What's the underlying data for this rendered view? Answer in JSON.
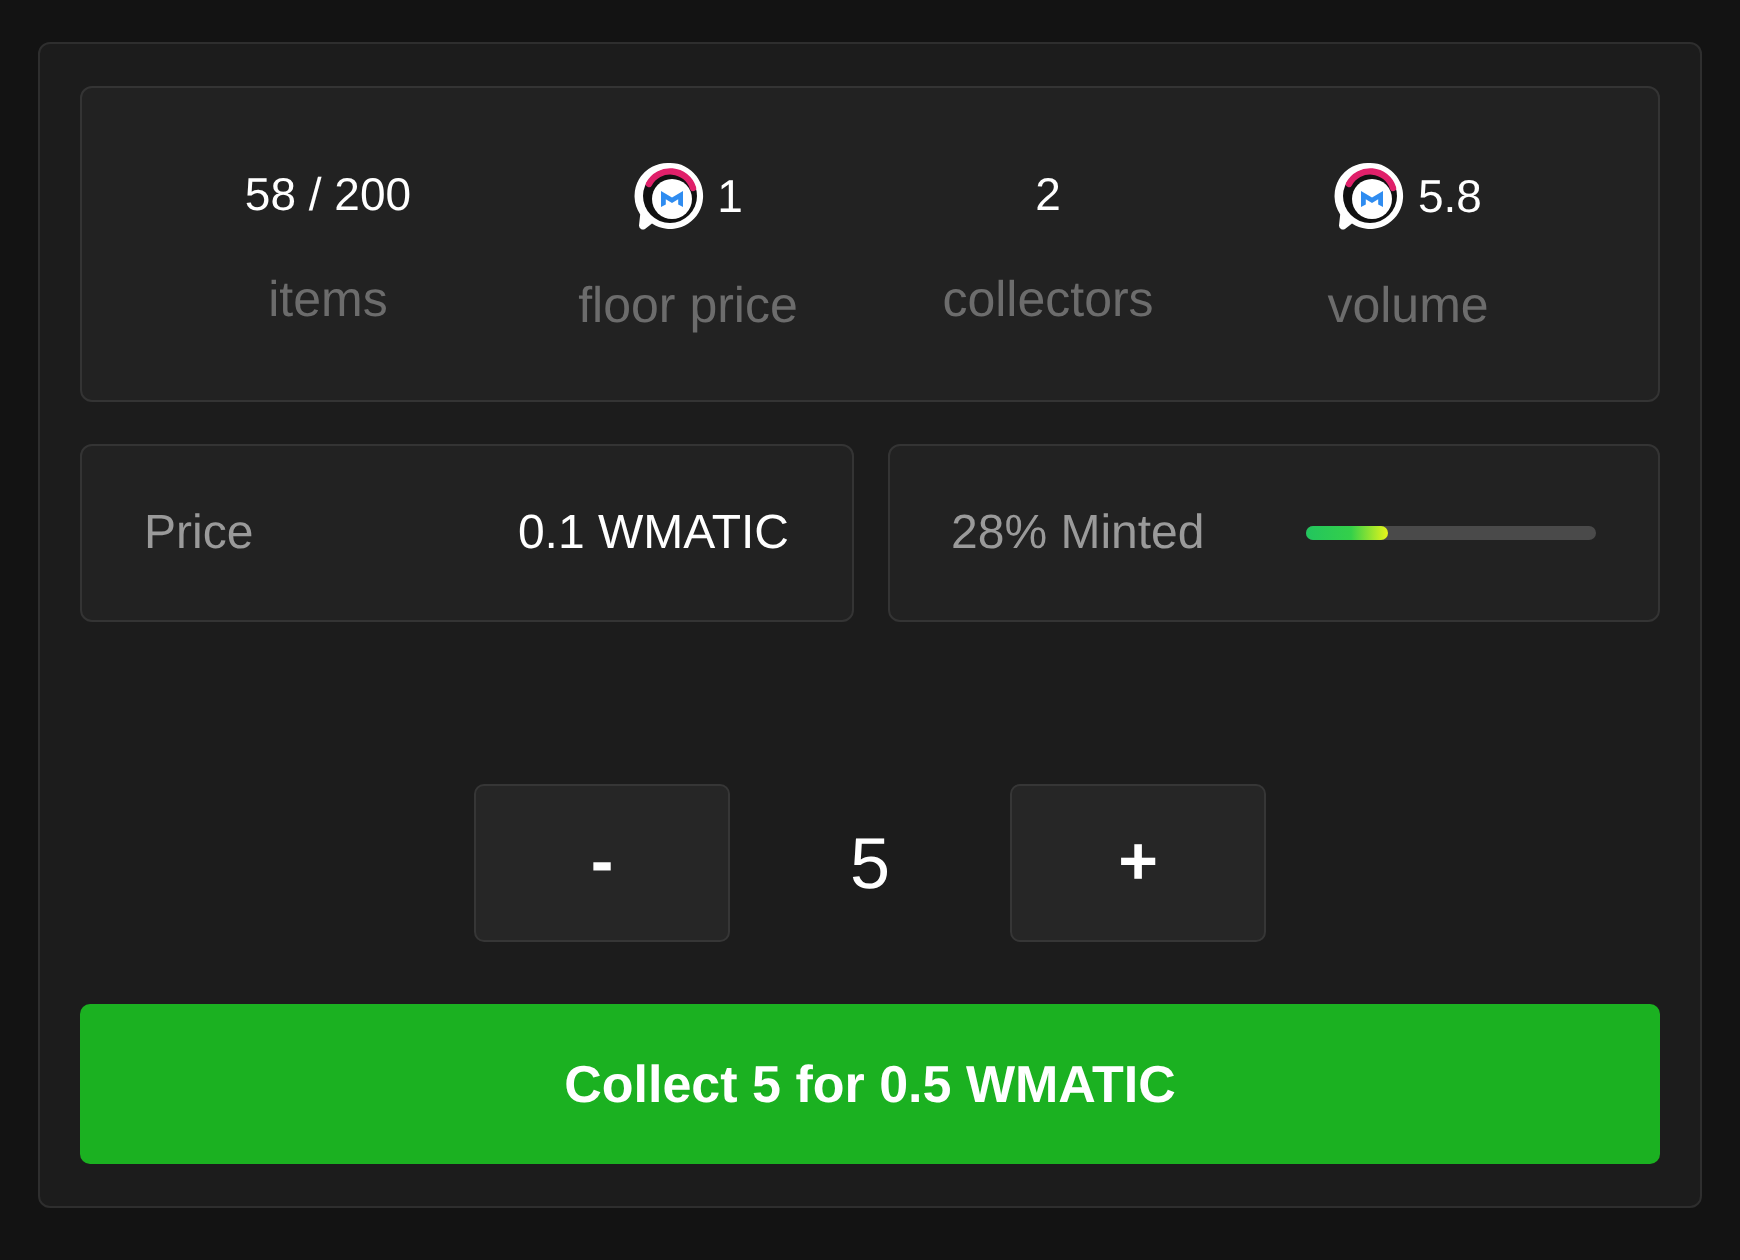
{
  "stats": [
    {
      "kind": "count",
      "value": "58 / 200",
      "label": "items"
    },
    {
      "kind": "token",
      "value": "1",
      "label": "floor price"
    },
    {
      "kind": "count",
      "value": "2",
      "label": "collectors"
    },
    {
      "kind": "token",
      "value": "5.8",
      "label": "volume"
    }
  ],
  "price": {
    "label": "Price",
    "value": "0.1 WMATIC"
  },
  "mint_progress": {
    "label": "28% Minted",
    "level": 0.28
  },
  "quantity": {
    "decrease": "-",
    "value": "5",
    "increase": "+"
  },
  "collect_button": {
    "label": "Collect 5 for 0.5 WMATIC"
  }
}
